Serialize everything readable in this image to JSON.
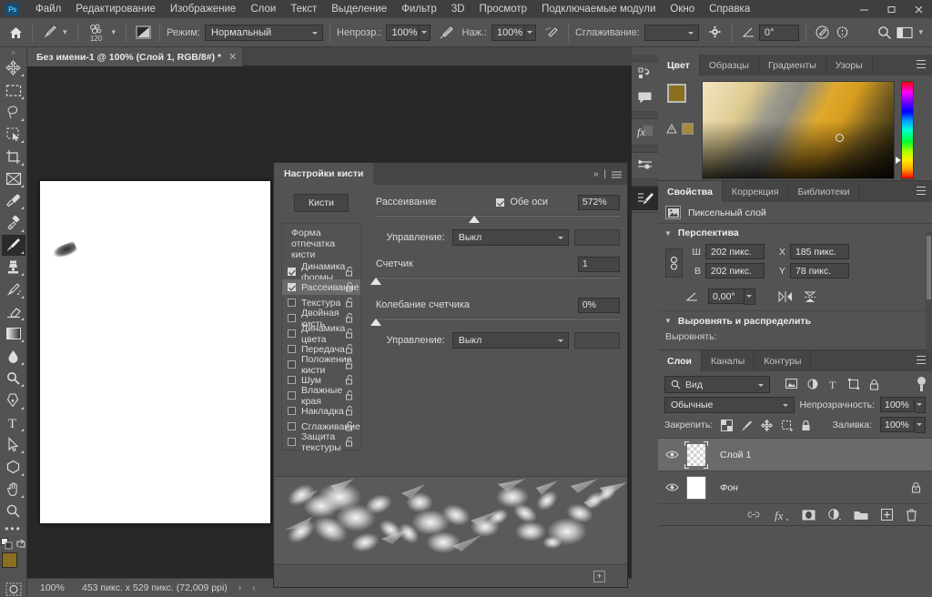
{
  "menubar": {
    "logo": "Ps",
    "items": [
      "Файл",
      "Редактирование",
      "Изображение",
      "Слои",
      "Текст",
      "Выделение",
      "Фильтр",
      "3D",
      "Просмотр",
      "Подключаемые модули",
      "Окно",
      "Справка"
    ],
    "window_buttons": [
      "minimize-icon",
      "maximize-icon",
      "close-icon"
    ]
  },
  "options_bar": {
    "home_icon": "home-icon",
    "tool_icon": "brush-icon",
    "brush_size": "120",
    "preset_icon": "brush-preset-icon",
    "mode_label": "Режим:",
    "mode_value": "Нормальный",
    "opacity_label": "Непрозр.:",
    "opacity_value": "100%",
    "pressure_opacity_icon": "pressure-opacity-icon",
    "flow_label": "Наж.:",
    "flow_value": "100%",
    "airbrush_icon": "airbrush-icon",
    "smoothing_label": "Сглаживание:",
    "smoothing_value": "",
    "gear_icon": "gear-icon",
    "angle_icon": "angle-icon",
    "angle_value": "0°",
    "pressure_size_icon": "pressure-size-icon",
    "symmetry_icon": "symmetry-icon",
    "search_icon": "search-icon",
    "workspace_icon": "workspace-icon"
  },
  "toolbar": {
    "expand_icon": "expand-toolbar-icon",
    "tools": [
      {
        "name": "move-tool",
        "active": false
      },
      {
        "name": "rectangular-marquee-tool",
        "active": false
      },
      {
        "name": "lasso-tool",
        "active": false
      },
      {
        "name": "object-selection-tool",
        "active": false
      },
      {
        "name": "crop-tool",
        "active": false
      },
      {
        "name": "frame-tool",
        "active": false
      },
      {
        "name": "eyedropper-tool",
        "active": false
      },
      {
        "name": "spot-healing-brush-tool",
        "active": false
      },
      {
        "name": "brush-tool",
        "active": true
      },
      {
        "name": "clone-stamp-tool",
        "active": false
      },
      {
        "name": "history-brush-tool",
        "active": false
      },
      {
        "name": "eraser-tool",
        "active": false
      },
      {
        "name": "gradient-tool",
        "active": false
      },
      {
        "name": "blur-tool",
        "active": false
      },
      {
        "name": "dodge-tool",
        "active": false
      },
      {
        "name": "pen-tool",
        "active": false
      },
      {
        "name": "type-tool",
        "active": false
      },
      {
        "name": "path-selection-tool",
        "active": false
      },
      {
        "name": "shape-tool",
        "active": false
      },
      {
        "name": "hand-tool",
        "active": false
      },
      {
        "name": "zoom-tool",
        "active": false
      }
    ],
    "more_tools_icon": "more-tools-icon",
    "default_colors_icon": "default-colors-icon",
    "swap_colors_icon": "swap-colors-icon",
    "foreground_color": "#8b6f1f",
    "background_color": "#d4b483",
    "quick_mask_icon": "quick-mask-icon"
  },
  "document": {
    "tab_title": "Без имени-1 @ 100% (Слой 1, RGB/8#) *",
    "close_icon": "close-icon"
  },
  "status_bar": {
    "zoom": "100%",
    "dimensions": "453 пикс. x 529 пикс. (72,009 ppi)",
    "arrow_right": "›",
    "arrow_left": "‹"
  },
  "icon_rail": {
    "buttons": [
      {
        "name": "history-icon"
      },
      {
        "name": "comments-icon"
      },
      {
        "name": "layer-styles-icon"
      },
      {
        "name": "adjustments-icon"
      },
      {
        "name": "brush-settings-icon",
        "active": true
      }
    ]
  },
  "brush_panel": {
    "tab": "Настройки кисти",
    "collapse_icon": "collapse-icon",
    "menu_icon": "panel-menu-icon",
    "brushes_button": "Кисти",
    "list_header": "Форма отпечатка кисти",
    "list_items": [
      {
        "label": "Динамика формы",
        "checked": true,
        "selected": false
      },
      {
        "label": "Рассеивание",
        "checked": true,
        "selected": true
      },
      {
        "label": "Текстура",
        "checked": false,
        "selected": false
      },
      {
        "label": "Двойная кисть",
        "checked": false,
        "selected": false
      },
      {
        "label": "Динамика цвета",
        "checked": false,
        "selected": false
      },
      {
        "label": "Передача",
        "checked": false,
        "selected": false
      },
      {
        "label": "Положение кисти",
        "checked": false,
        "selected": false
      },
      {
        "label": "Шум",
        "checked": false,
        "selected": false
      },
      {
        "label": "Влажные края",
        "checked": false,
        "selected": false
      },
      {
        "label": "Накладка",
        "checked": false,
        "selected": false
      },
      {
        "label": "Сглаживание",
        "checked": false,
        "selected": false
      },
      {
        "label": "Защита текстуры",
        "checked": false,
        "selected": false
      }
    ],
    "lock_icon": "lock-open-icon",
    "scatter": {
      "label": "Рассеивание",
      "both_axes_label": "Обе оси",
      "both_axes_checked": true,
      "value": "572%",
      "slider_percent": 38
    },
    "scatter_control": {
      "label": "Управление:",
      "value": "Выкл"
    },
    "count": {
      "label": "Счетчик",
      "value": "1",
      "slider_percent": 0
    },
    "count_jitter": {
      "label": "Колебание счетчика",
      "value": "0%",
      "slider_percent": 0
    },
    "count_jitter_control": {
      "label": "Управление:",
      "value": "Выкл"
    },
    "preview_name": "brush-stroke-preview",
    "new_brush_icon": "new-brush-icon"
  },
  "color_panel": {
    "tabs": [
      {
        "label": "Цвет",
        "active": true
      },
      {
        "label": "Образцы",
        "active": false
      },
      {
        "label": "Градиенты",
        "active": false
      },
      {
        "label": "Узоры",
        "active": false
      }
    ],
    "menu_icon": "panel-menu-icon",
    "foreground_color": "#8b6f1f",
    "background_color": "#d4b483",
    "out_of_gamut_icon": "gamut-warning-icon",
    "gamut_swatch_color": "#a9893f",
    "picker_icon": "color-picker-ring",
    "hue_slider_icon": "hue-slider"
  },
  "properties_panel": {
    "tabs": [
      {
        "label": "Свойства",
        "active": true
      },
      {
        "label": "Коррекция",
        "active": false
      },
      {
        "label": "Библиотеки",
        "active": false
      }
    ],
    "menu_icon": "panel-menu-icon",
    "layer_type_icon": "pixel-layer-icon",
    "layer_type": "Пиксельный слой",
    "transform_section": "Перспектива",
    "fields": [
      {
        "label": "Ш",
        "value": "202 пикс."
      },
      {
        "label": "В",
        "value": "202 пикс."
      },
      {
        "label": "X",
        "value": "185 пикс."
      },
      {
        "label": "Y",
        "value": "78 пикс."
      }
    ],
    "link_icon": "link-dimensions-icon",
    "angle_icon": "angle-icon",
    "angle_value": "0,00°",
    "flip_horizontal_icon": "flip-horizontal-icon",
    "flip_vertical_icon": "flip-vertical-icon",
    "align_section": "Выровнять и распределить",
    "align_label": "Выровнять:"
  },
  "layers_panel": {
    "tabs": [
      {
        "label": "Слои",
        "active": true
      },
      {
        "label": "Каналы",
        "active": false
      },
      {
        "label": "Контуры",
        "active": false
      }
    ],
    "menu_icon": "panel-menu-icon",
    "filter_icon": "search-icon",
    "filter_value": "Вид",
    "filter_type_icons": [
      "pixel-filter-icon",
      "adjustment-filter-icon",
      "type-filter-icon",
      "shape-filter-icon",
      "smart-object-filter-icon"
    ],
    "filter_toggle_icon": "filter-toggle-icon",
    "blend_mode": "Обычные",
    "opacity_label": "Непрозрачность:",
    "opacity_value": "100%",
    "lock_label": "Закрепить:",
    "lock_icons": [
      "lock-transparent-pixels-icon",
      "lock-image-pixels-icon",
      "lock-position-icon",
      "lock-artboard-icon",
      "lock-all-icon"
    ],
    "fill_label": "Заливка:",
    "fill_value": "100%",
    "layers": [
      {
        "name": "Слой 1",
        "visible": true,
        "selected": true,
        "thumb": "transparent",
        "locked": false,
        "italic": false
      },
      {
        "name": "Фон",
        "visible": true,
        "selected": false,
        "thumb": "white",
        "locked": true,
        "italic": true
      }
    ],
    "eye_icon": "eye-icon",
    "footer_icons": [
      "link-layers-icon",
      "layer-style-fx-icon",
      "layer-mask-icon",
      "adjustment-layer-icon",
      "new-group-icon",
      "new-layer-icon",
      "delete-layer-icon"
    ]
  }
}
